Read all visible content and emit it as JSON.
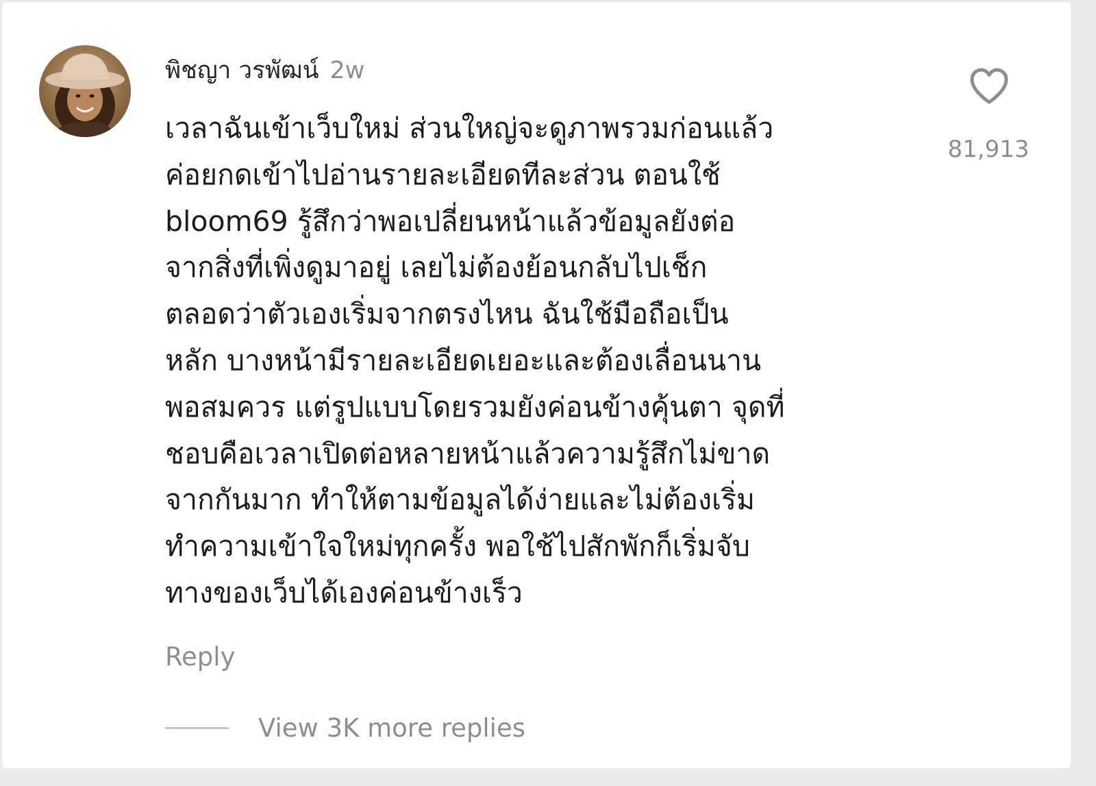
{
  "comment": {
    "username": "พิชญา วรพัฒน์",
    "timestamp": "2w",
    "text": "เวลาฉันเข้าเว็บใหม่ ส่วนใหญ่จะดูภาพรวมก่อนแล้ว\nค่อยกดเข้าไปอ่านรายละเอียดทีละส่วน ตอนใช้\nbloom69 รู้สึกว่าพอเปลี่ยนหน้าแล้วข้อมูลยังต่อ\nจากสิ่งที่เพิ่งดูมาอยู่ เลยไม่ต้องย้อนกลับไปเช็ก\nตลอดว่าตัวเองเริ่มจากตรงไหน ฉันใช้มือถือเป็น\nหลัก บางหน้ามีรายละเอียดเยอะและต้องเลื่อนนาน\nพอสมควร แต่รูปแบบโดยรวมยังค่อนข้างคุ้นตา จุดที่\nชอบคือเวลาเปิดต่อหลายหน้าแล้วความรู้สึกไม่ขาด\nจากกันมาก ทำให้ตามข้อมูลได้ง่ายและไม่ต้องเริ่ม\nทำความเข้าใจใหม่ทุกครั้ง พอใช้ไปสักพักก็เริ่มจับ\nทางของเว็บได้เองค่อนข้างเร็ว",
    "like_count": "81,913",
    "reply_label": "Reply",
    "view_replies_label": "View 3K more replies",
    "icons": {
      "avatar": "avatar-photo",
      "like": "heart-outline-icon"
    }
  },
  "colors": {
    "username": "#262626",
    "secondary_text": "#8e8e8e",
    "body_text": "#1c1c1c",
    "divider": "#c7c7c7"
  }
}
